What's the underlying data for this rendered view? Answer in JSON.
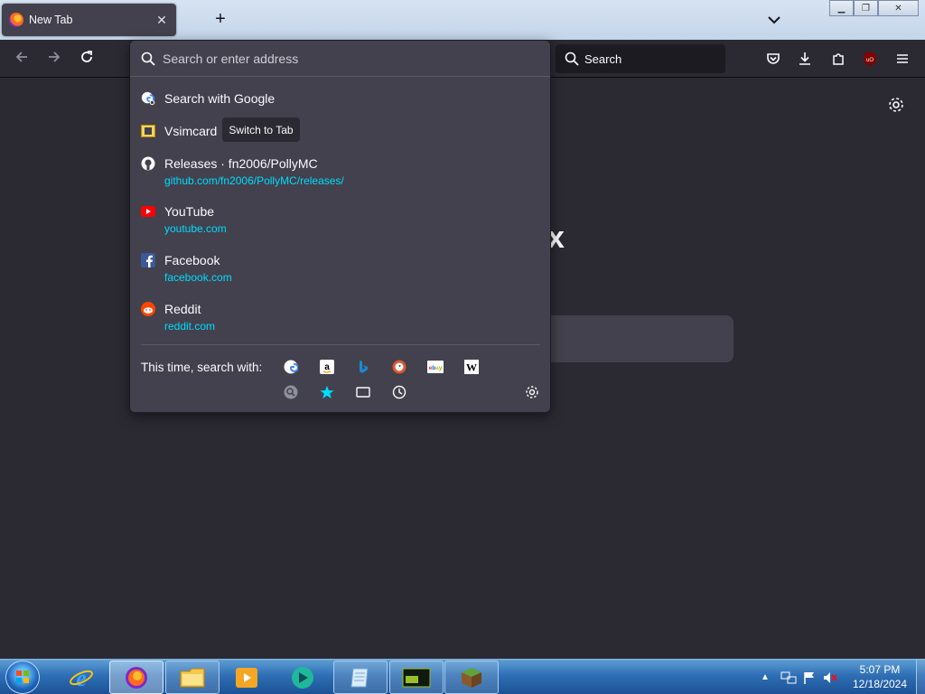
{
  "tabs": [
    {
      "title": "New Tab"
    }
  ],
  "toolbar": {
    "search_label": "Search"
  },
  "urlbar": {
    "placeholder": "Search or enter address",
    "results": [
      {
        "title": "Search with Google",
        "url": ""
      },
      {
        "title": "Vsimcard",
        "url": "",
        "badge": "Switch to Tab"
      },
      {
        "title": "Releases · fn2006/PollyMC",
        "url": "github.com/fn2006/PollyMC/releases/"
      },
      {
        "title": "YouTube",
        "url": "youtube.com"
      },
      {
        "title": "Facebook",
        "url": "facebook.com"
      },
      {
        "title": "Reddit",
        "url": "reddit.com"
      }
    ],
    "search_with_label": "This time, search with:",
    "engines": [
      "google",
      "amazon",
      "bing",
      "duckduckgo",
      "ebay",
      "wikipedia"
    ],
    "modes": [
      "search-mode",
      "bookmarks",
      "tabs",
      "history"
    ]
  },
  "newtab": {
    "logo_fragment": "x"
  },
  "taskbar": {
    "clock_time": "5:07 PM",
    "clock_date": "12/18/2024",
    "apps": [
      "internet-explorer",
      "firefox",
      "file-explorer",
      "media-player",
      "app-teal",
      "app-notepad",
      "app-terminal",
      "app-minecraft"
    ]
  },
  "colors": {
    "accent": "#00ddff",
    "panel": "#42414d",
    "background": "#2b2a33"
  }
}
